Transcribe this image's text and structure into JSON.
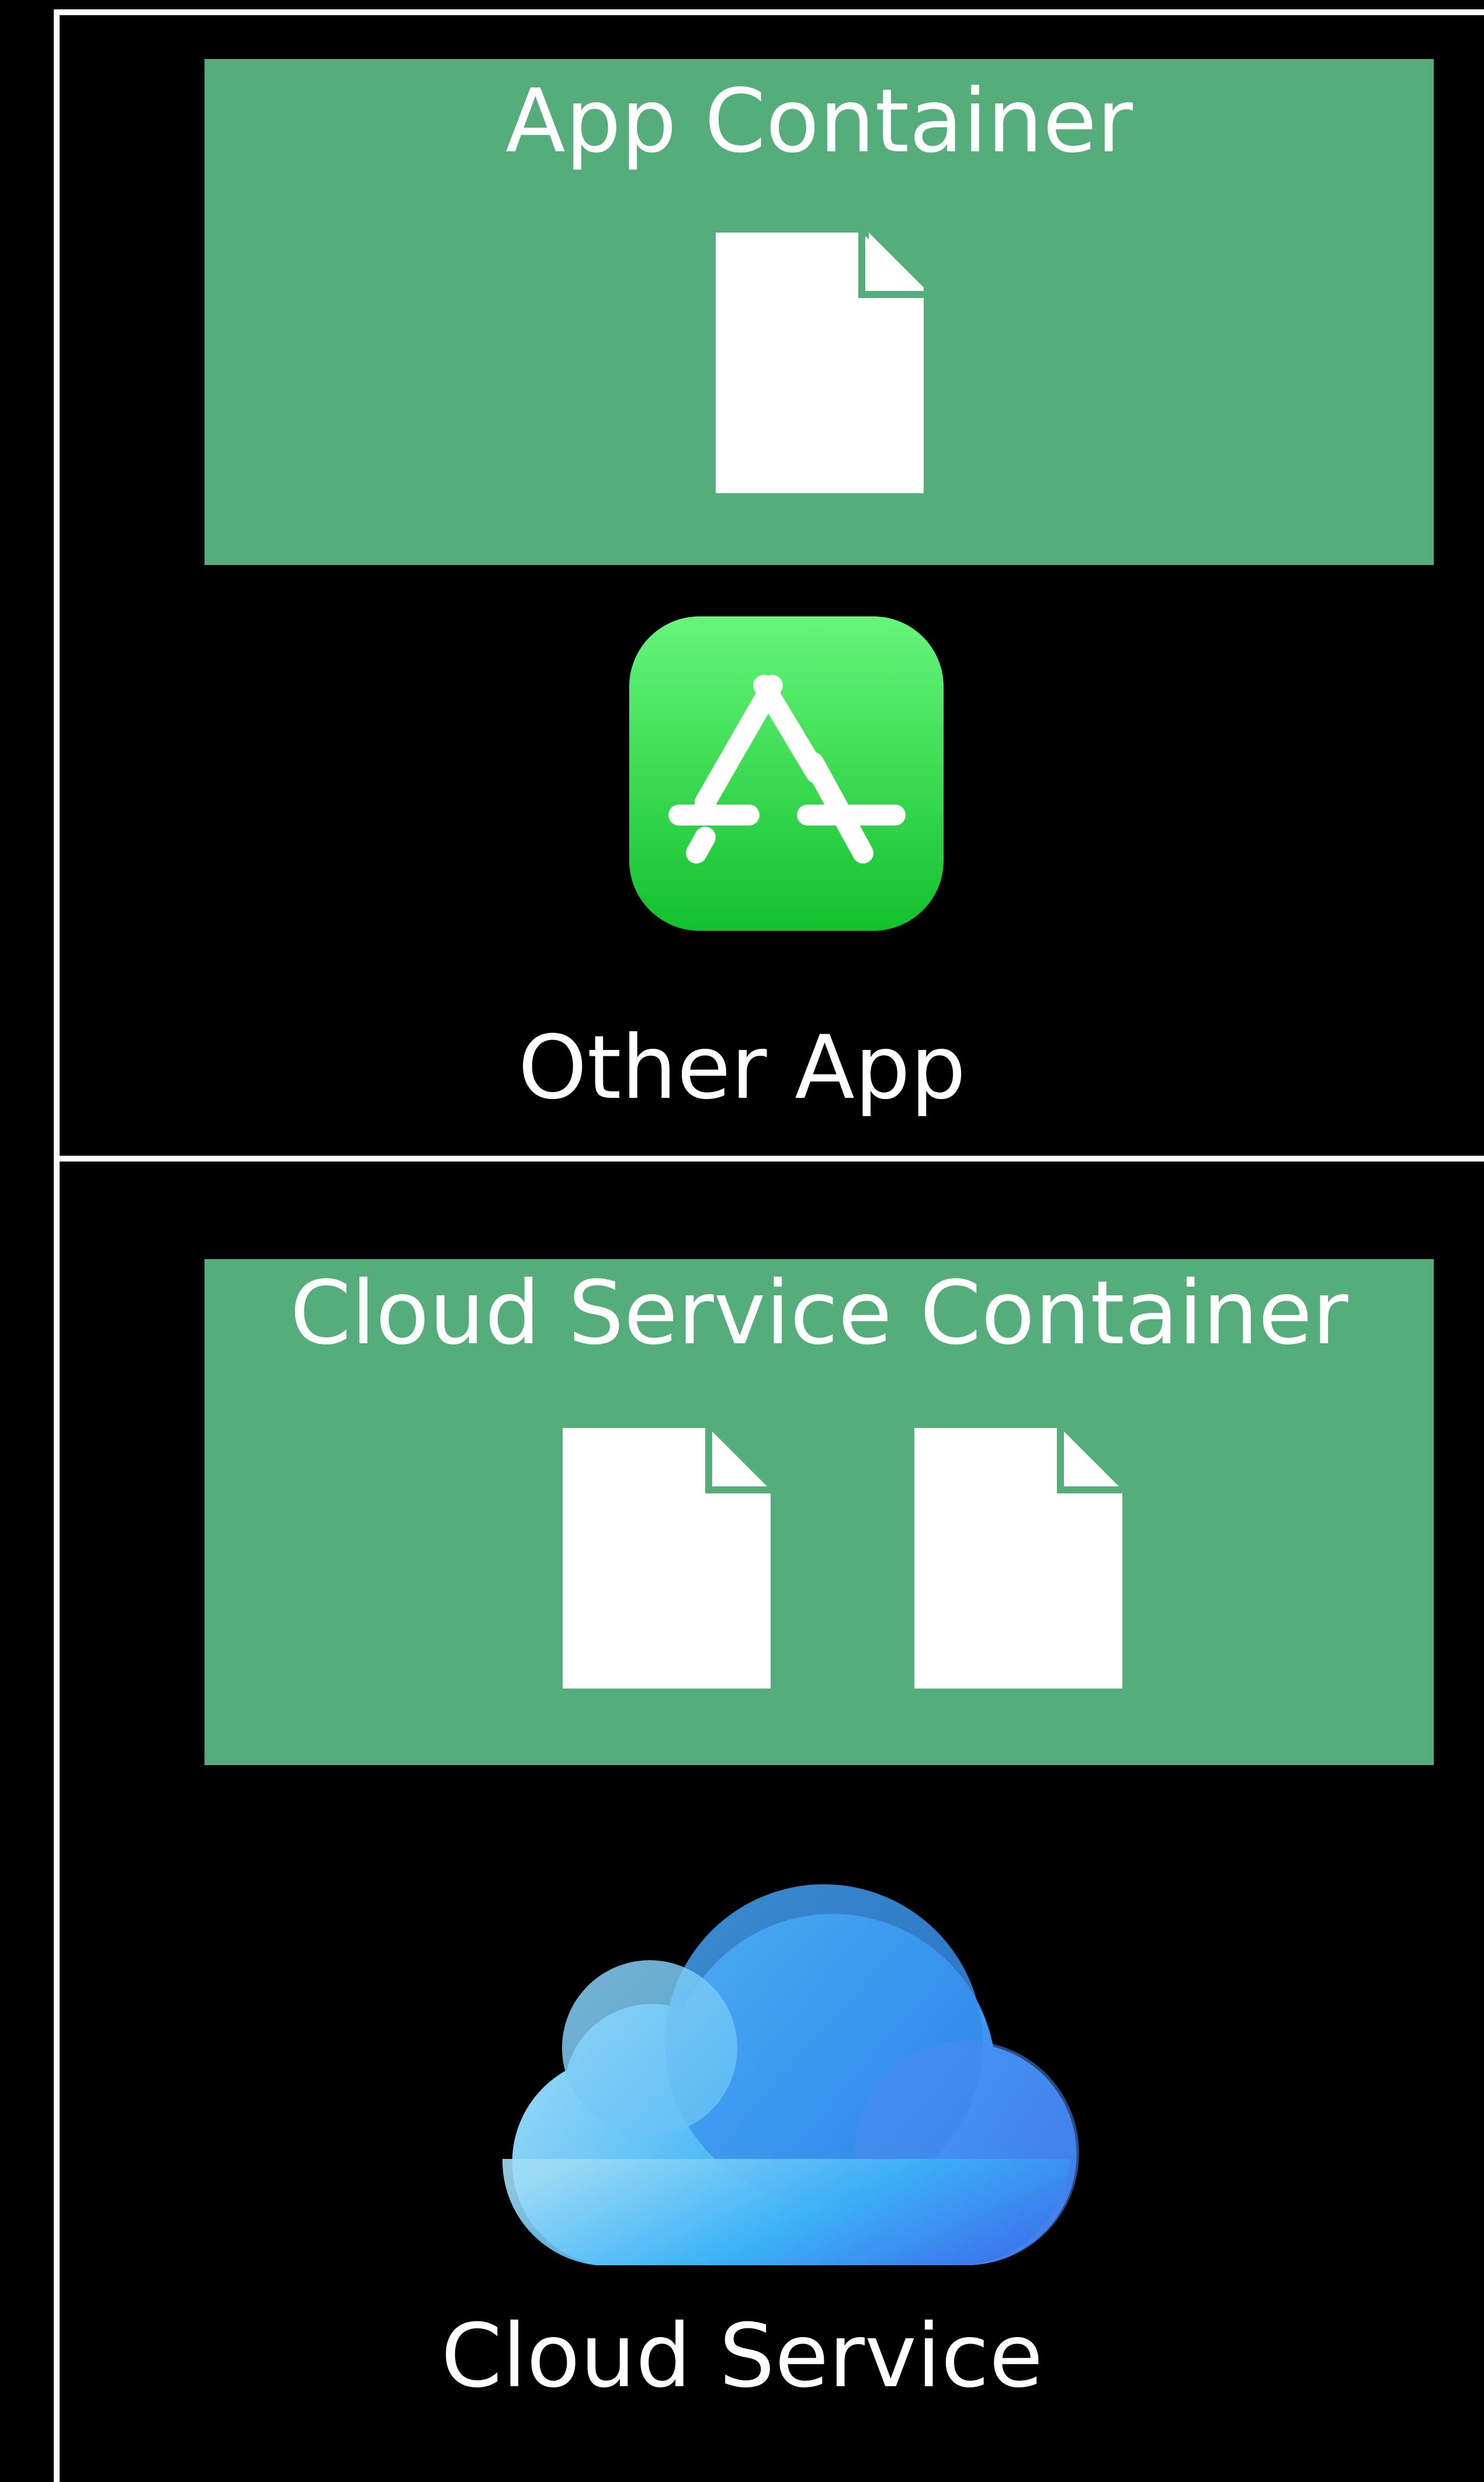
{
  "app_container": {
    "title": "App Container",
    "documents": [
      "document-icon"
    ]
  },
  "other_app": {
    "label": "Other App",
    "icon": "app-store-icon"
  },
  "cloud_container": {
    "title": "Cloud Service Container",
    "documents": [
      "document-icon",
      "document-icon"
    ]
  },
  "cloud_service": {
    "label": "Cloud Service",
    "icon": "icloud-icon"
  },
  "colors": {
    "background": "#000000",
    "container_fill": "#56ad7c",
    "frame_line": "#ffffff",
    "app_icon_top": "#66f57a",
    "app_icon_bottom": "#13c12d",
    "cloud_light": "#8fd6f8",
    "cloud_dark": "#3b78ee"
  }
}
